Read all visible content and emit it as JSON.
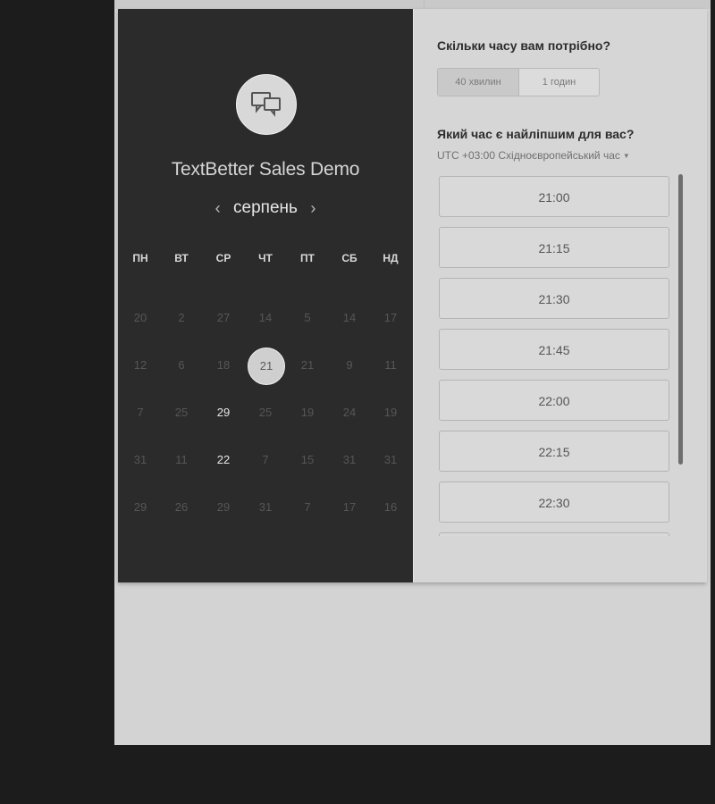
{
  "company": {
    "name": "TextBetter Sales Demo",
    "avatar_icon": "chat-bubbles-icon"
  },
  "calendar": {
    "month": "серпень",
    "prev_arrow": "‹",
    "next_arrow": "›",
    "weekdays": [
      "ПН",
      "ВТ",
      "СР",
      "ЧТ",
      "ПТ",
      "СБ",
      "НД"
    ],
    "rows": [
      [
        "20",
        "2",
        "27",
        "14",
        "5",
        "14",
        "17"
      ],
      [
        "12",
        "6",
        "18",
        "21",
        "21",
        "9",
        "11"
      ],
      [
        "7",
        "25",
        "29",
        "25",
        "19",
        "24",
        "19"
      ],
      [
        "31",
        "11",
        "22",
        "7",
        "15",
        "31",
        "31"
      ],
      [
        "29",
        "26",
        "29",
        "31",
        "7",
        "17",
        "16"
      ]
    ],
    "available_days": [
      "29",
      "22"
    ],
    "selected_day": "21"
  },
  "booking": {
    "duration_question": "Скільки часу вам потрібно?",
    "duration_options": [
      "40 хвилин",
      "1 годин"
    ],
    "selected_duration": "40 хвилин",
    "time_question": "Який час є найліпшим для вас?",
    "timezone": "UTC +03:00 Східноєвропейський час",
    "time_slots": [
      "21:00",
      "21:15",
      "21:30",
      "21:45",
      "22:00",
      "22:15",
      "22:30"
    ]
  },
  "colors": {
    "left_panel_bg": "#2b2b2b",
    "right_panel_bg": "#d6d6d6",
    "outer_bg": "#1c1c1c"
  }
}
